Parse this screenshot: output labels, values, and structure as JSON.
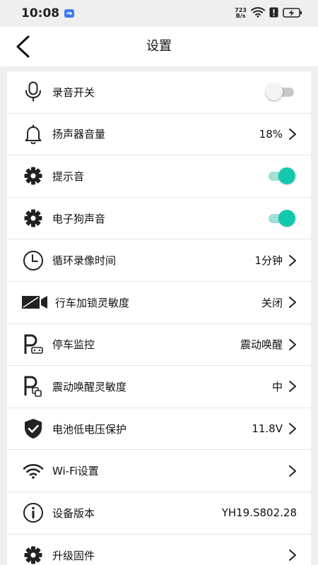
{
  "status_bar": {
    "time": "10:08",
    "net_speed_value": "723",
    "net_speed_unit": "B/s"
  },
  "header": {
    "title": "设置"
  },
  "settings": [
    {
      "label": "录音开关",
      "icon": "microphone-icon",
      "type": "toggle",
      "on": false
    },
    {
      "label": "扬声器音量",
      "icon": "bell-icon",
      "type": "value",
      "value": "18%"
    },
    {
      "label": "提示音",
      "icon": "gear-icon",
      "type": "toggle",
      "on": true
    },
    {
      "label": "电子狗声音",
      "icon": "gear-icon",
      "type": "toggle",
      "on": true
    },
    {
      "label": "循环录像时间",
      "icon": "clock-icon",
      "type": "value",
      "value": "1分钟"
    },
    {
      "label": "行车加锁灵敏度",
      "icon": "video-camera-icon",
      "type": "value",
      "value": "关闭"
    },
    {
      "label": "停车监控",
      "icon": "parking-monitor-icon",
      "type": "value",
      "value": "震动唤醒"
    },
    {
      "label": "震动唤醒灵敏度",
      "icon": "parking-vibration-icon",
      "type": "value",
      "value": "中"
    },
    {
      "label": "电池低电压保护",
      "icon": "shield-check-icon",
      "type": "value",
      "value": "11.8V"
    },
    {
      "label": "Wi-Fi设置",
      "icon": "wifi-icon",
      "type": "value",
      "value": ""
    },
    {
      "label": "设备版本",
      "icon": "info-icon",
      "type": "info",
      "value": "YH19.S802.28"
    },
    {
      "label": "升级固件",
      "icon": "gear-icon",
      "type": "value",
      "value": ""
    }
  ],
  "colors": {
    "toggle_on": "#12c9ae",
    "toggle_on_track": "#9fe1d8",
    "toggle_off_track": "#c8c8c8",
    "background": "#efefef"
  }
}
